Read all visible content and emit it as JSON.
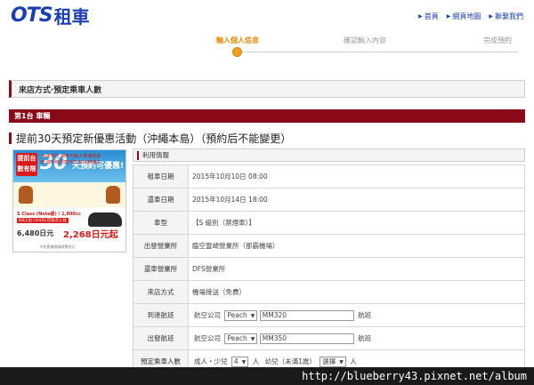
{
  "logo": {
    "ots": "OTS",
    "cn": "租車"
  },
  "toplinks": [
    {
      "label": "首頁"
    },
    {
      "label": "網頁地圖"
    },
    {
      "label": "聯繫我們"
    }
  ],
  "steps": [
    {
      "label": "輸入個人信息"
    },
    {
      "label": "確認輸入內容"
    },
    {
      "label": "完成預約"
    }
  ],
  "section_title": "來店方式‧預定乘車人數",
  "car_bar": "第1台 車輛",
  "campaign": "提前30天預定新優惠活動（沖繩本島）（預約后不能變更）",
  "promo": {
    "badge": "提前台數有限",
    "big": "30",
    "sub": "天預約可優惠!",
    "mid_text": "全車款皆 擁有可嵌入車導航系統 或手機同款汽FLAUX熱播子.",
    "class_line": "S Class (Note級) / 1,800cc",
    "days_line": "8天1泊 (3/4天)可再次入住",
    "price_old": "6,480日元",
    "price_new": "2,268日元起",
    "note": "※免責補償險保費另計"
  },
  "info_header": "利用情報",
  "rows": [
    {
      "label": "租車日期",
      "value": "2015年10月10日 08:00"
    },
    {
      "label": "還車日期",
      "value": "2015年10月14日 18:00"
    },
    {
      "label": "車型",
      "value": "【S 級別（禁煙車）】"
    },
    {
      "label": "出發營業所",
      "value": "臨空豐崎營業所（那霸機場）"
    },
    {
      "label": "還車營業所",
      "value": "DFS營業所"
    },
    {
      "label": "來店方式",
      "value": "機場接送（免費）"
    }
  ],
  "arrival": {
    "label": "到達航班",
    "airline_label": "航空公司",
    "airline": "Peach",
    "flight": "MM320",
    "suffix": "航班"
  },
  "departure": {
    "label": "出發航班",
    "airline_label": "航空公司",
    "airline": "Peach",
    "flight": "MM350",
    "suffix": "航班"
  },
  "passengers": {
    "label": "預定乘車人數",
    "adult_label": "成人・少兒",
    "adult_value": "4",
    "adult_unit": "人",
    "infant_label": "幼兒（未滿1歲）",
    "infant_value": "選擇",
    "infant_unit": "人"
  },
  "watermark": "http://blueberry43.pixnet.net/album",
  "colors": {
    "brand": "#1a3fb0",
    "accent": "#8b0a1a",
    "step_active": "#e8890a"
  }
}
